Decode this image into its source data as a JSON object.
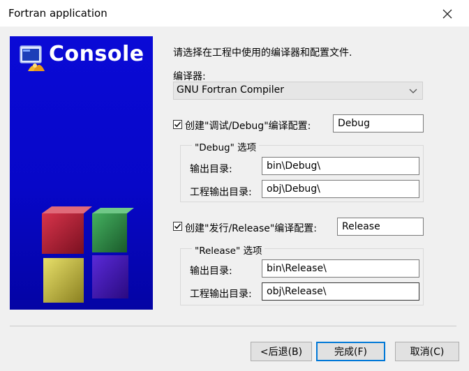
{
  "window": {
    "title": "Fortran application"
  },
  "banner": {
    "title": "Console"
  },
  "intro": "请选择在工程中使用的编译器和配置文件.",
  "compiler": {
    "label": "编译器:",
    "selected": "GNU Fortran Compiler"
  },
  "debug": {
    "checkbox_label": "创建\"调试/Debug\"编译配置:",
    "checked": true,
    "name": "Debug",
    "group_title": "\"Debug\" 选项",
    "output_label": "输出目录:",
    "output_value": "bin\\Debug\\",
    "objects_label": "工程输出目录:",
    "objects_value": "obj\\Debug\\"
  },
  "release": {
    "checkbox_label": "创建\"发行/Release\"编译配置:",
    "checked": true,
    "name": "Release",
    "group_title": "\"Release\" 选项",
    "output_label": "输出目录:",
    "output_value": "bin\\Release\\",
    "objects_label": "工程输出目录:",
    "objects_value": "obj\\Release\\"
  },
  "buttons": {
    "back": "<后退(B)",
    "finish": "完成(F)",
    "cancel": "取消(C)"
  },
  "colors": {
    "banner_blue": "#0707c8",
    "accent": "#0078d7",
    "dialog_bg": "#f0f0f0"
  }
}
